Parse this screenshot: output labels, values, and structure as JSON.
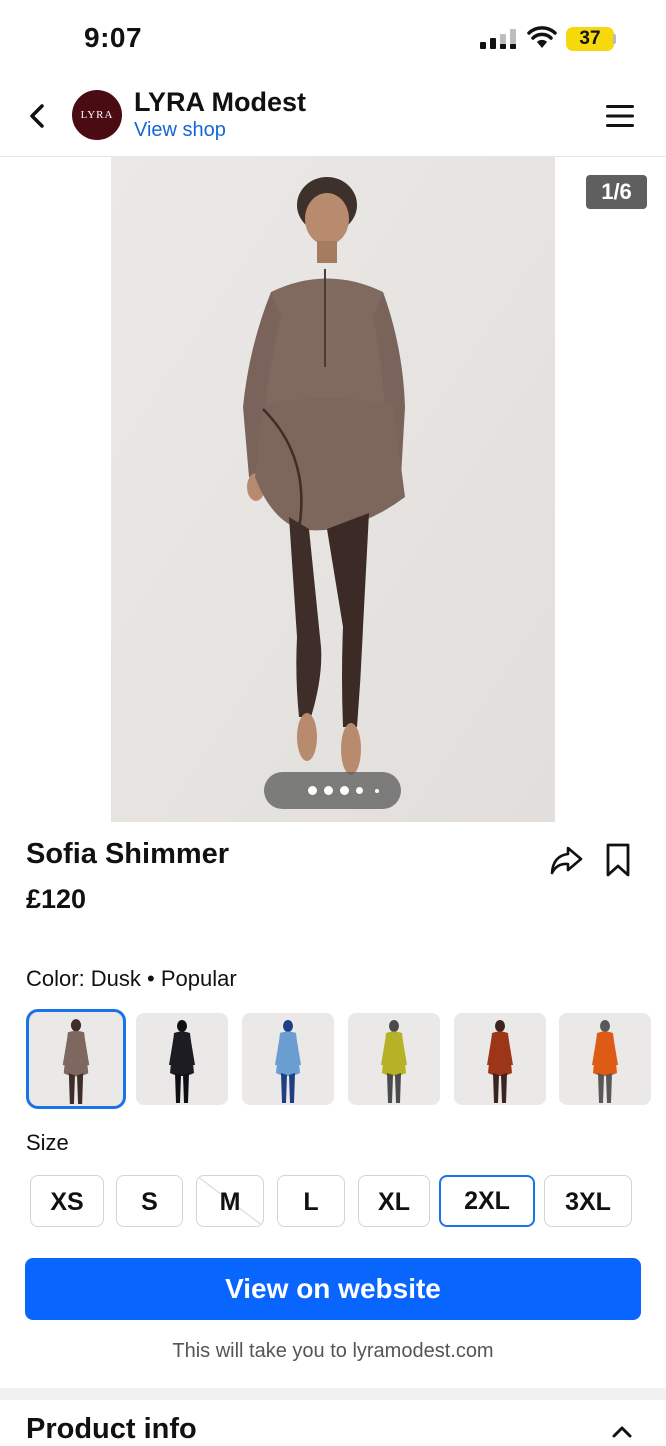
{
  "status_bar": {
    "time": "9:07",
    "battery": "37"
  },
  "header": {
    "avatar_text": "LYRA",
    "shop_name": "LYRA Modest",
    "view_shop": "View shop"
  },
  "gallery": {
    "counter": "1/6",
    "dot_count": 5,
    "active_dot": 0
  },
  "product": {
    "title": "Sofia Shimmer",
    "price": "£120"
  },
  "color": {
    "label": "Color: Dusk • Popular",
    "swatches": [
      {
        "name": "Dusk",
        "top": "#7e675f",
        "bottom": "#3f2d29",
        "selected": true
      },
      {
        "name": "Black",
        "top": "#1c1c22",
        "bottom": "#101014",
        "selected": false
      },
      {
        "name": "Sky",
        "top": "#6a9ed0",
        "bottom": "#1f3e84",
        "selected": false
      },
      {
        "name": "Lime",
        "top": "#b5b227",
        "bottom": "#4b4b4b",
        "selected": false
      },
      {
        "name": "Rust",
        "top": "#9d3519",
        "bottom": "#3c2420",
        "selected": false
      },
      {
        "name": "Orange",
        "top": "#de5b15",
        "bottom": "#585858",
        "selected": false
      }
    ]
  },
  "size": {
    "label": "Size",
    "options": [
      {
        "label": "XS",
        "selected": false,
        "unavailable": false
      },
      {
        "label": "S",
        "selected": false,
        "unavailable": false
      },
      {
        "label": "M",
        "selected": false,
        "unavailable": true
      },
      {
        "label": "L",
        "selected": false,
        "unavailable": false
      },
      {
        "label": "XL",
        "selected": false,
        "unavailable": false
      },
      {
        "label": "2XL",
        "selected": true,
        "unavailable": false
      },
      {
        "label": "3XL",
        "selected": false,
        "unavailable": false
      }
    ]
  },
  "cta": {
    "label": "View on website",
    "note": "This will take you to lyramodest.com"
  },
  "product_info": {
    "title": "Product info"
  },
  "colors": {
    "accent": "#0866ff",
    "select_border": "#1a73e8",
    "link": "#1866d6",
    "battery": "#f5d90a"
  }
}
